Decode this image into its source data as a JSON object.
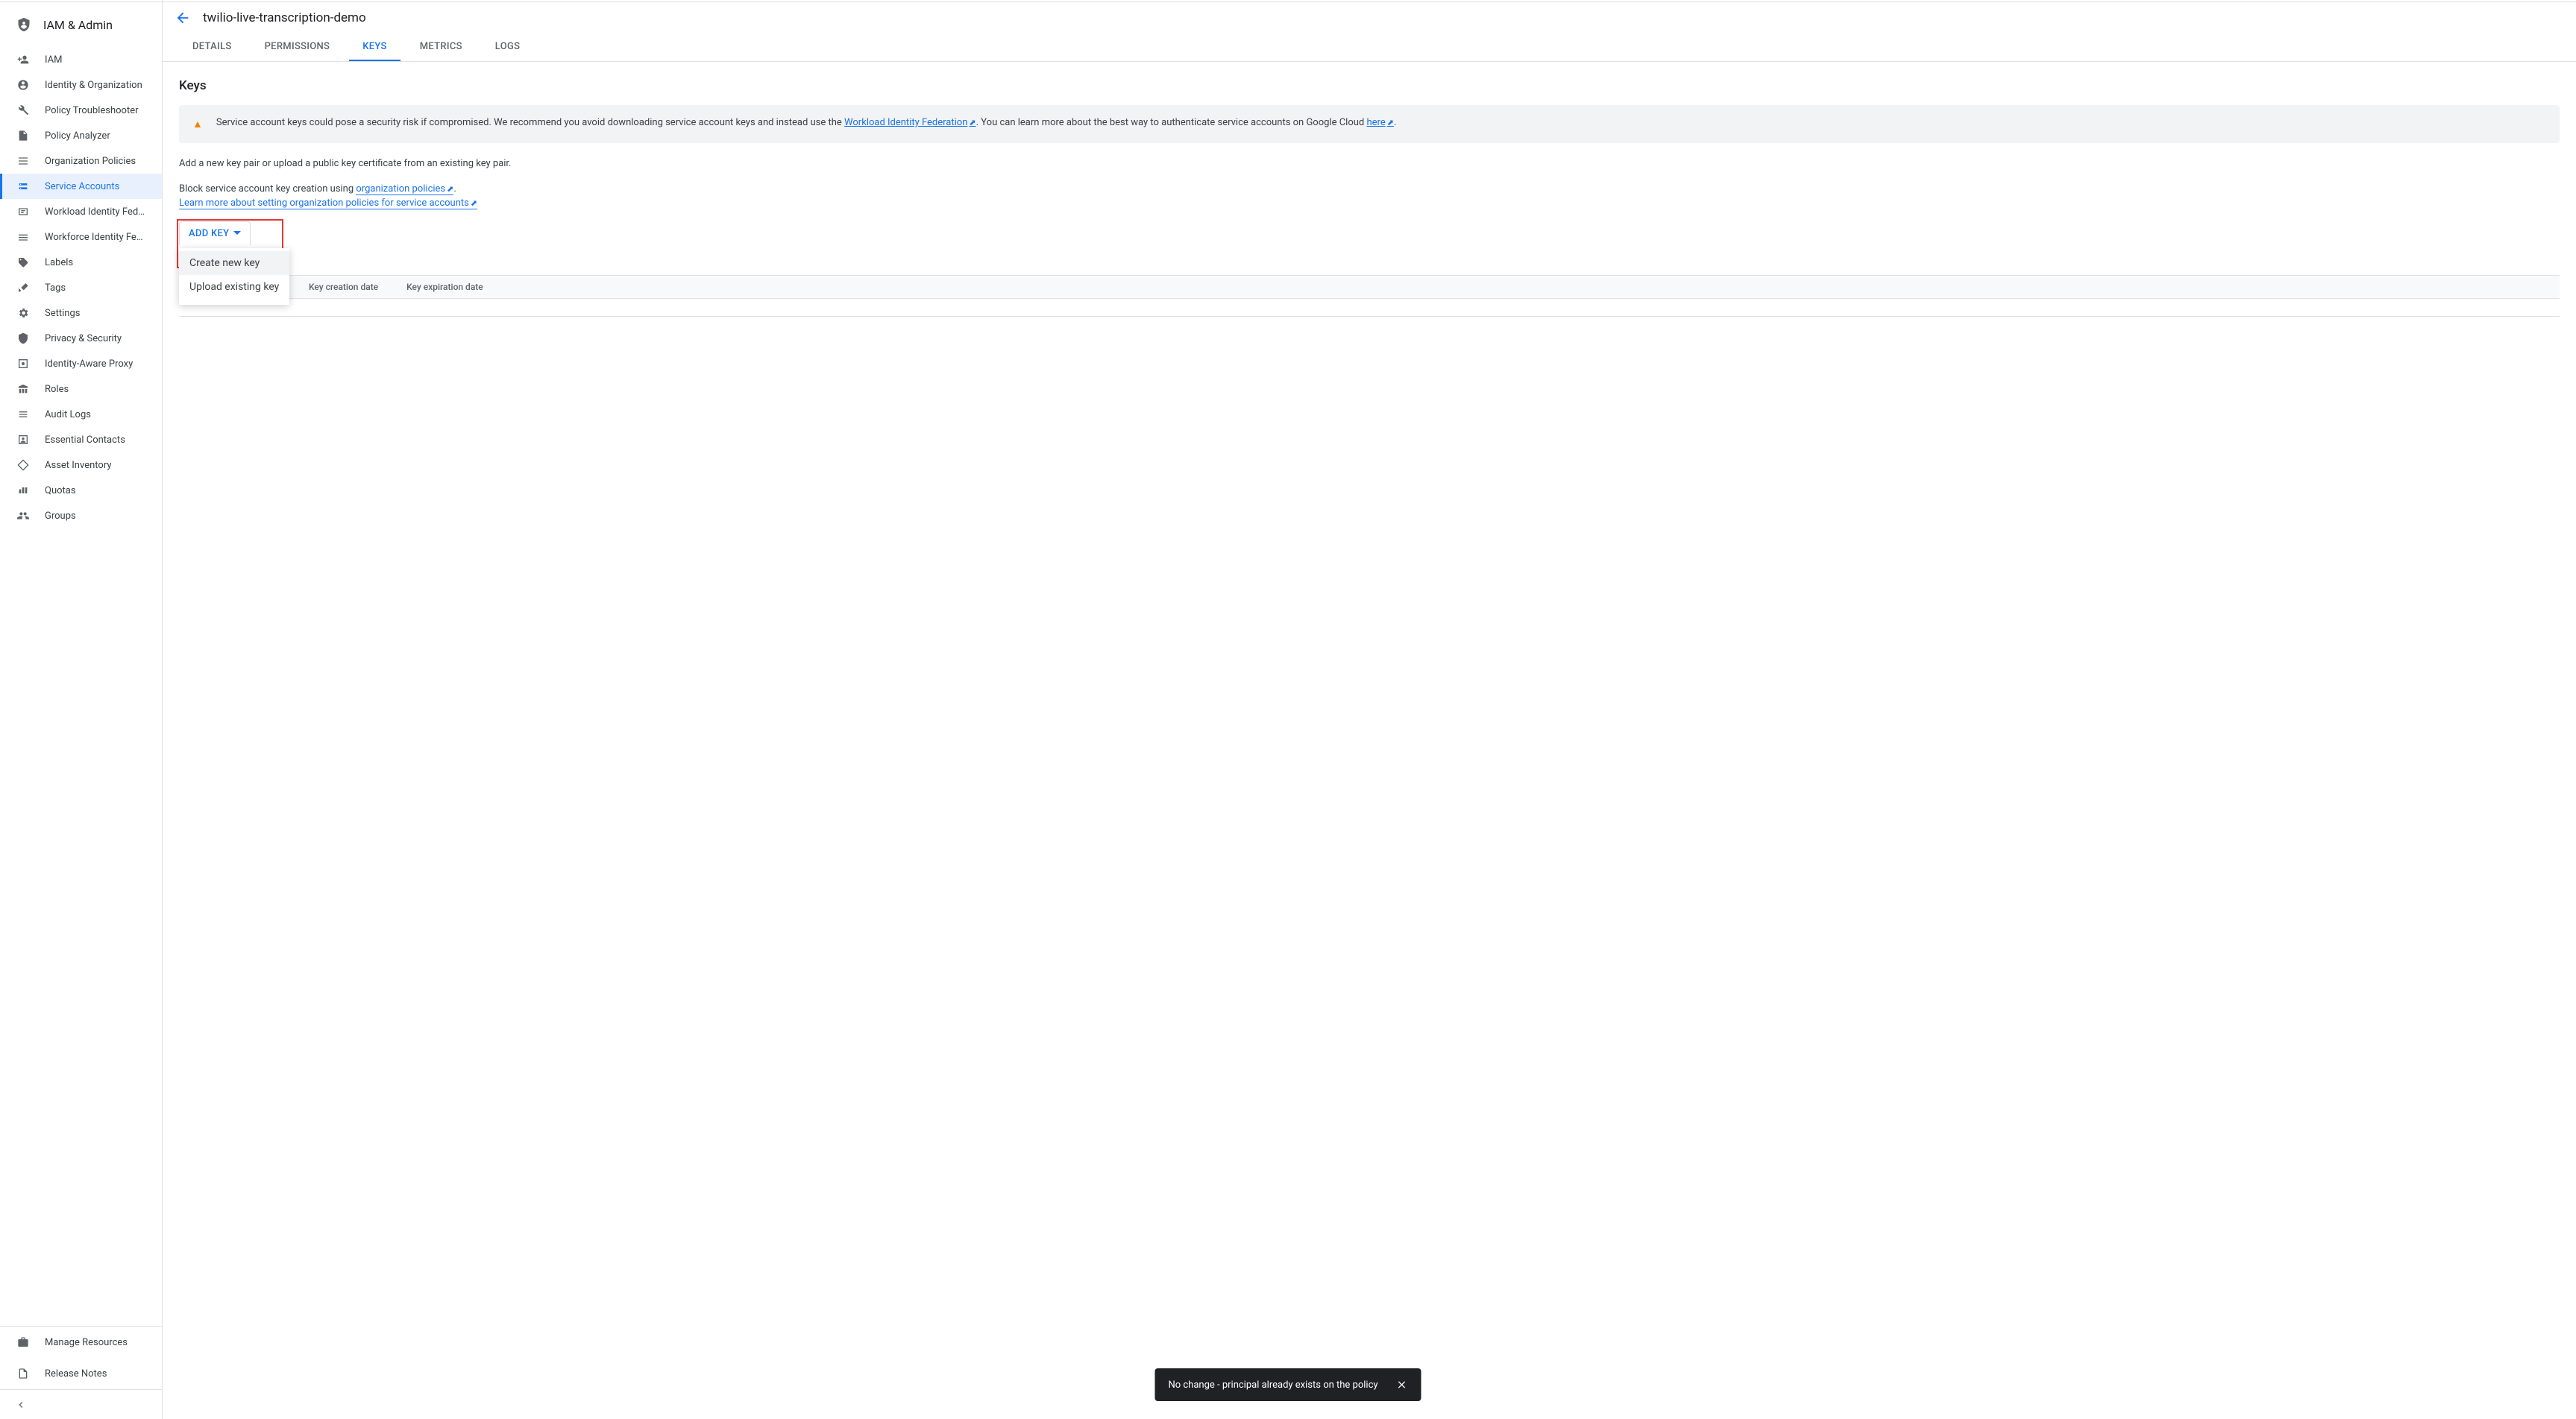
{
  "sidebar": {
    "title": "IAM & Admin",
    "items": [
      {
        "label": "IAM",
        "icon": "person-add"
      },
      {
        "label": "Identity & Organization",
        "icon": "account-circle"
      },
      {
        "label": "Policy Troubleshooter",
        "icon": "wrench"
      },
      {
        "label": "Policy Analyzer",
        "icon": "doc-list"
      },
      {
        "label": "Organization Policies",
        "icon": "list-box"
      },
      {
        "label": "Service Accounts",
        "icon": "service-account",
        "active": true
      },
      {
        "label": "Workload Identity Federat...",
        "icon": "wif"
      },
      {
        "label": "Workforce Identity Federa...",
        "icon": "workforce"
      },
      {
        "label": "Labels",
        "icon": "tag"
      },
      {
        "label": "Tags",
        "icon": "tags"
      },
      {
        "label": "Settings",
        "icon": "gear"
      },
      {
        "label": "Privacy & Security",
        "icon": "shield"
      },
      {
        "label": "Identity-Aware Proxy",
        "icon": "iap"
      },
      {
        "label": "Roles",
        "icon": "roles"
      },
      {
        "label": "Audit Logs",
        "icon": "list"
      },
      {
        "label": "Essential Contacts",
        "icon": "contacts"
      },
      {
        "label": "Asset Inventory",
        "icon": "diamond"
      },
      {
        "label": "Quotas",
        "icon": "bar"
      },
      {
        "label": "Groups",
        "icon": "groups"
      }
    ],
    "bottom": [
      {
        "label": "Manage Resources",
        "icon": "bag"
      },
      {
        "label": "Release Notes",
        "icon": "notes"
      }
    ]
  },
  "header": {
    "title": "twilio-live-transcription-demo"
  },
  "tabs": {
    "items": [
      "DETAILS",
      "PERMISSIONS",
      "KEYS",
      "METRICS",
      "LOGS"
    ],
    "active": 2
  },
  "page": {
    "section_title": "Keys",
    "banner_text_1": "Service account keys could pose a security risk if compromised. We recommend you avoid downloading service account keys and instead use the ",
    "banner_link_1": "Workload Identity Federation",
    "banner_text_2": ". You can learn more about the best way to authenticate service accounts on Google Cloud ",
    "banner_link_2": "here",
    "banner_text_3": ".",
    "intro_text": "Add a new key pair or upload a public key certificate from an existing key pair.",
    "block_text_1": "Block service account key creation using ",
    "block_link_1": "organization policies",
    "block_text_2": ".",
    "learn_link": "Learn more about setting organization policies for service accounts",
    "add_key_label": "ADD KEY",
    "dropdown": {
      "items": [
        "Create new key",
        "Upload existing key"
      ]
    },
    "table_headers": [
      "Key creation date",
      "Key expiration date"
    ]
  },
  "toast": {
    "message": "No change - principal already exists on the policy"
  }
}
